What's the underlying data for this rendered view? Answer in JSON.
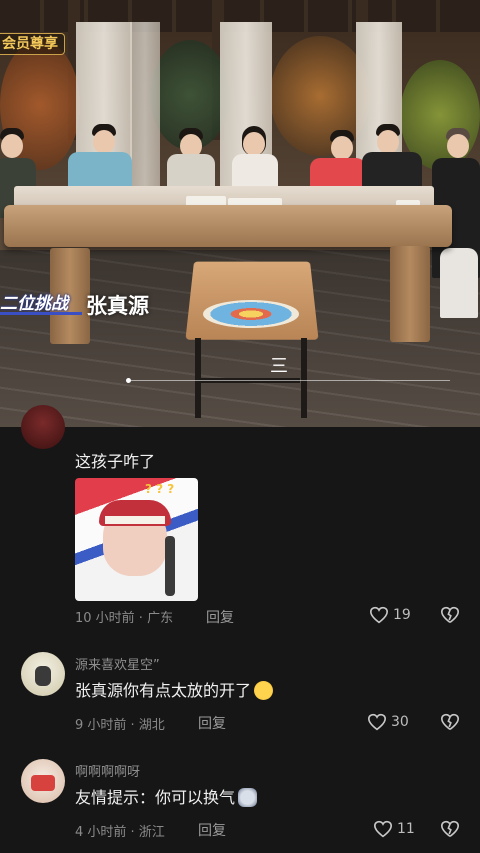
{
  "video": {
    "badge": "会员尊享",
    "subtitle_left": "二位挑战",
    "subtitle_name": "张真源",
    "menu_glyph": "三",
    "progress": 0.0
  },
  "comments": [
    {
      "username": "",
      "text": "这孩子咋了",
      "has_sticker": true,
      "sticker_caption": "? ? ?",
      "time": "10 小时前 · 广东",
      "reply_label": "回复",
      "likes": "19"
    },
    {
      "username": "源来喜欢星空”",
      "text": "张真源你有点太放的开了",
      "emoji": "crying-face-emoji",
      "time": "9 小时前 · 湖北",
      "reply_label": "回复",
      "likes": "30"
    },
    {
      "username": "啊啊啊啊呀",
      "text": "友情提示：你可以换气",
      "emoji": "cat-face-emoji",
      "time": "4 小时前 · 浙江",
      "reply_label": "回复",
      "likes": "11"
    }
  ],
  "colors": {
    "background": "#161616",
    "badge_gold": "#f2c85a",
    "subtitle_blue": "#3b4fc4"
  }
}
